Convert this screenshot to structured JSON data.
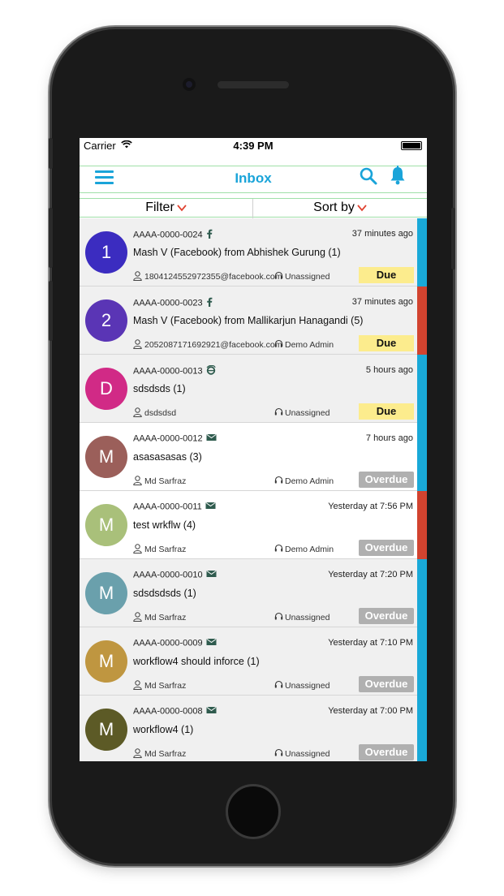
{
  "statusbar": {
    "carrier": "Carrier",
    "time": "4:39 PM"
  },
  "navbar": {
    "title": "Inbox",
    "menu_icon": "hamburger-menu-icon",
    "search_icon": "search-icon",
    "bell_icon": "bell-icon"
  },
  "filterbar": {
    "filter_label": "Filter",
    "sort_label": "Sort by"
  },
  "colors": {
    "accent": "#1aa4d9",
    "chevron": "#e0412f",
    "prio_blue": "#19a9d8",
    "prio_red": "#d2432f",
    "due_bg": "#fcec8d",
    "overdue_bg": "#b0b0b0"
  },
  "tickets": [
    {
      "initial": "1",
      "avatar_color": "#3b2cc0",
      "id": "AAAA-0000-0024",
      "channel": "facebook-icon",
      "time": "37 minutes ago",
      "subject": "Mash V (Facebook) from Abhishek Gurung (1)",
      "contact": "1804124552972355@facebook.com",
      "assignee": "Unassigned",
      "status": "Due Today",
      "priority": "blue",
      "bg": "grey"
    },
    {
      "initial": "2",
      "avatar_color": "#5a35b5",
      "id": "AAAA-0000-0023",
      "channel": "facebook-icon",
      "time": "37 minutes ago",
      "subject": "Mash V (Facebook) from Mallikarjun Hanagandi (5)",
      "contact": "2052087171692921@facebook.com",
      "assignee": "Demo Admin",
      "status": "Due Today",
      "priority": "red",
      "bg": "grey"
    },
    {
      "initial": "D",
      "avatar_color": "#d12a86",
      "id": "AAAA-0000-0013",
      "channel": "web-icon",
      "time": "5 hours ago",
      "subject": "sdsdsds (1)",
      "contact": "dsdsdsd",
      "assignee": "Unassigned",
      "status": "Due Today",
      "priority": "blue",
      "bg": "grey"
    },
    {
      "initial": "M",
      "avatar_color": "#9b5f5a",
      "id": "AAAA-0000-0012",
      "channel": "email-icon",
      "time": "7 hours ago",
      "subject": "asasasasas (3)",
      "contact": "Md Sarfraz",
      "assignee": "Demo Admin",
      "status": "Overdue",
      "priority": "blue",
      "bg": "white"
    },
    {
      "initial": "M",
      "avatar_color": "#a9c07a",
      "id": "AAAA-0000-0011",
      "channel": "email-icon",
      "time": "Yesterday at 7:56 PM",
      "subject": "test wrkflw (4)",
      "contact": "Md Sarfraz",
      "assignee": "Demo Admin",
      "status": "Overdue",
      "priority": "red",
      "bg": "white"
    },
    {
      "initial": "M",
      "avatar_color": "#6aa0ac",
      "id": "AAAA-0000-0010",
      "channel": "email-icon",
      "time": "Yesterday at 7:20 PM",
      "subject": "sdsdsdsds (1)",
      "contact": "Md Sarfraz",
      "assignee": "Unassigned",
      "status": "Overdue",
      "priority": "blue",
      "bg": "grey"
    },
    {
      "initial": "M",
      "avatar_color": "#bf9640",
      "id": "AAAA-0000-0009",
      "channel": "email-icon",
      "time": "Yesterday at 7:10 PM",
      "subject": "workflow4 should inforce (1)",
      "contact": "Md Sarfraz",
      "assignee": "Unassigned",
      "status": "Overdue",
      "priority": "blue",
      "bg": "grey"
    },
    {
      "initial": "M",
      "avatar_color": "#5c5a26",
      "id": "AAAA-0000-0008",
      "channel": "email-icon",
      "time": "Yesterday at 7:00 PM",
      "subject": "workflow4 (1)",
      "contact": "Md Sarfraz",
      "assignee": "Unassigned",
      "status": "Overdue",
      "priority": "blue",
      "bg": "grey"
    }
  ]
}
